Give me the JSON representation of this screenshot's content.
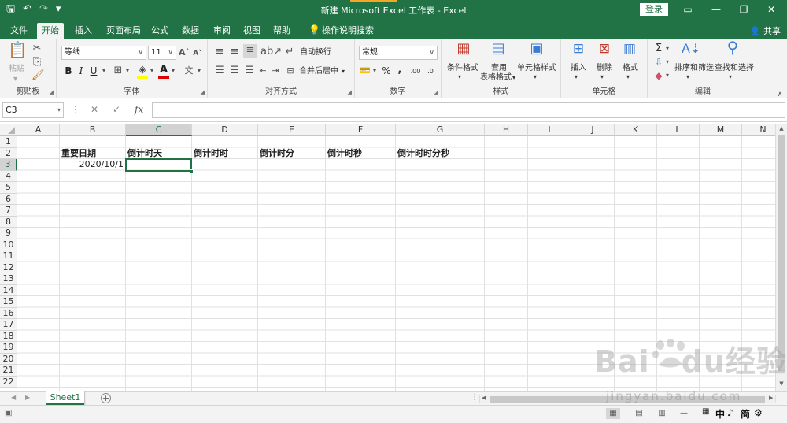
{
  "titlebar": {
    "qat": {
      "save": "🖫",
      "undo": "↶",
      "redo": "↷",
      "customize": "▾"
    },
    "title": "新建 Microsoft Excel 工作表  -  Excel",
    "login": "登录",
    "window_controls": [
      "▭",
      "—",
      "❐",
      "✕"
    ],
    "accent_color": "#217346"
  },
  "tabs": [
    "文件",
    "开始",
    "插入",
    "页面布局",
    "公式",
    "数据",
    "审阅",
    "视图",
    "帮助",
    "操作说明搜索"
  ],
  "active_tab": "开始",
  "share": "共享",
  "ribbon": {
    "clipboard": {
      "label": "剪贴板",
      "paste": "粘贴"
    },
    "font": {
      "label": "字体",
      "name": "等线",
      "size": "11",
      "bold": "B",
      "italic": "I",
      "underline": "U"
    },
    "alignment": {
      "label": "对齐方式",
      "wrap": "自动换行",
      "merge": "合并后居中"
    },
    "number": {
      "label": "数字",
      "format": "常规"
    },
    "styles": {
      "label": "样式",
      "conditional": "条件格式",
      "table_1": "套用",
      "table_2": "表格格式",
      "cell_styles": "单元格样式"
    },
    "cells": {
      "label": "单元格",
      "insert": "插入",
      "delete": "删除",
      "format": "格式"
    },
    "editing": {
      "label": "编辑",
      "sort": "排序和筛选",
      "find": "查找和选择"
    }
  },
  "formula_bar": {
    "name_box": "C3",
    "formula": "",
    "fx": "fx"
  },
  "columns": [
    "A",
    "B",
    "C",
    "D",
    "E",
    "F",
    "G",
    "H",
    "I",
    "J",
    "K",
    "L",
    "M",
    "N"
  ],
  "rows": [
    "1",
    "2",
    "3",
    "4",
    "5",
    "6",
    "7",
    "8",
    "9",
    "10",
    "11",
    "12",
    "13",
    "14",
    "15",
    "16",
    "17",
    "18",
    "19",
    "20",
    "21",
    "22"
  ],
  "cells": {
    "B2": "重要日期",
    "C2": "倒计时天",
    "D2": "倒计时时",
    "E2": "倒计时分",
    "F2": "倒计时秒",
    "G2": "倒计时时分秒",
    "B3": "2020/10/1"
  },
  "selected_cell": "C3",
  "sheets": [
    "Sheet1"
  ],
  "statusbar": {
    "ime": [
      "中",
      "♪",
      "简",
      "⚙"
    ]
  },
  "watermark": {
    "main": "Bai",
    "mid": "du",
    "cn": "经验",
    "sub": "jingyan.baidu.com"
  }
}
